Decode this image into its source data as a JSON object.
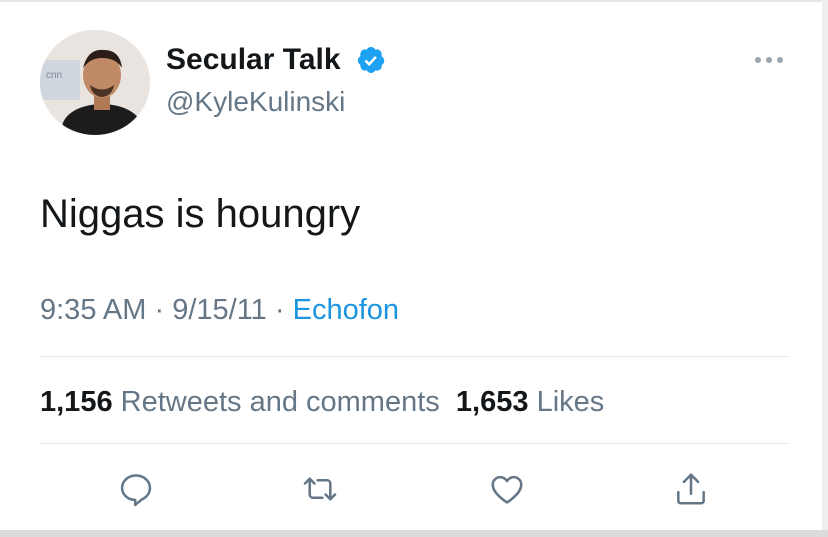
{
  "tweet": {
    "display_name": "Secular Talk",
    "handle": "@KyleKulinski",
    "verified": true,
    "text": "Niggas is houngry",
    "time": "9:35 AM",
    "date": "9/15/11",
    "separator": "·",
    "source": "Echofon"
  },
  "stats": {
    "retweets_count": "1,156",
    "retweets_label": "Retweets and comments",
    "likes_count": "1,653",
    "likes_label": "Likes"
  },
  "icons": {
    "more": "more-horizontal-icon",
    "reply": "reply-icon",
    "retweet": "retweet-icon",
    "like": "heart-icon",
    "share": "share-icon",
    "verified": "verified-badge-icon"
  },
  "colors": {
    "primary_text": "#14171a",
    "secondary_text": "#657786",
    "link": "#1b95e0",
    "verified": "#1da1f2",
    "divider": "#e1e8ed"
  }
}
